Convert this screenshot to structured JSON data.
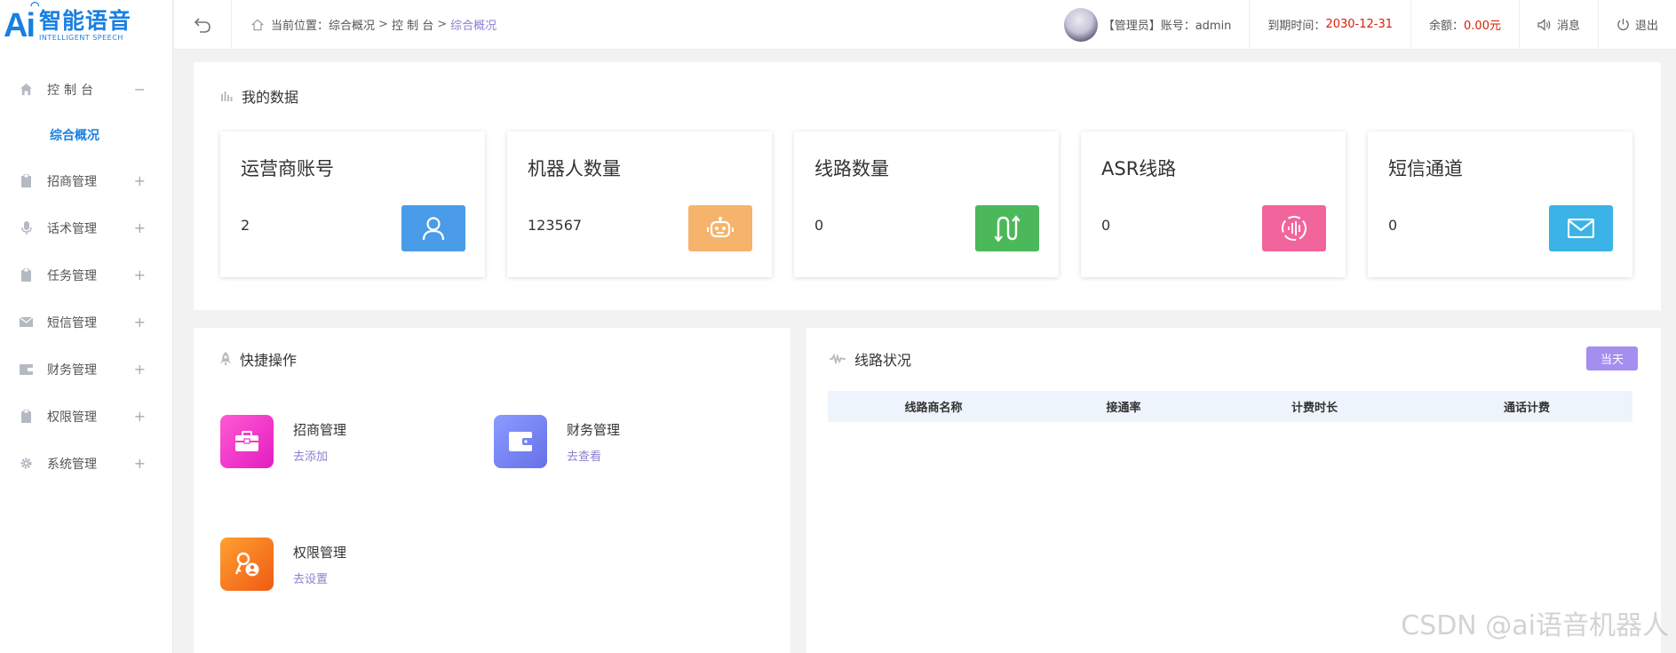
{
  "logo": {
    "mark": "Ai",
    "cn": "智能语音",
    "en": "INTELLIGENT SPEECH"
  },
  "sidebar": {
    "items": [
      {
        "label": "控制台",
        "icon": "home-icon",
        "toggle": "−"
      },
      {
        "label": "招商管理",
        "icon": "clipboard-icon",
        "toggle": "+"
      },
      {
        "label": "话术管理",
        "icon": "microphone-icon",
        "toggle": "+"
      },
      {
        "label": "任务管理",
        "icon": "clipboard-icon",
        "toggle": "+"
      },
      {
        "label": "短信管理",
        "icon": "mail-icon",
        "toggle": "+"
      },
      {
        "label": "财务管理",
        "icon": "wallet-icon",
        "toggle": "+"
      },
      {
        "label": "权限管理",
        "icon": "clipboard-icon",
        "toggle": "+"
      },
      {
        "label": "系统管理",
        "icon": "gear-icon",
        "toggle": "+"
      }
    ],
    "subitem": "综合概况"
  },
  "header": {
    "location_label": "当前位置：",
    "crumbs": [
      "综合概况",
      "控 制 台",
      "综合概况"
    ],
    "sep": ">",
    "account": "【管理员】账号：admin",
    "expire_label": "到期时间：",
    "expire_value": "2030-12-31",
    "balance_label": "余额：",
    "balance_value": "0.00元",
    "messages": "消息",
    "logout": "退出"
  },
  "my_data": {
    "title": "我的数据",
    "cards": [
      {
        "name": "运营商账号",
        "value": "2",
        "icon": "user-icon",
        "color": "#4a9be8"
      },
      {
        "name": "机器人数量",
        "value": "123567",
        "icon": "robot-icon",
        "color": "#f5b36b"
      },
      {
        "name": "线路数量",
        "value": "0",
        "icon": "route-icon",
        "color": "#4bb85a"
      },
      {
        "name": "ASR线路",
        "value": "0",
        "icon": "voice-icon",
        "color": "#f2649c"
      },
      {
        "name": "短信通道",
        "value": "0",
        "icon": "mail-icon",
        "color": "#3bb3e6"
      }
    ]
  },
  "quick_ops": {
    "title": "快捷操作",
    "items": [
      {
        "name": "招商管理",
        "link": "去添加",
        "icon": "briefcase-icon"
      },
      {
        "name": "财务管理",
        "link": "去查看",
        "icon": "wallet-icon"
      },
      {
        "name": "权限管理",
        "link": "去设置",
        "icon": "key-user-icon"
      }
    ]
  },
  "line_status": {
    "title": "线路状况",
    "button": "当天",
    "columns": [
      "线路商名称",
      "接通率",
      "计费时长",
      "通话计费"
    ]
  },
  "watermark": "CSDN @ai语音机器人"
}
